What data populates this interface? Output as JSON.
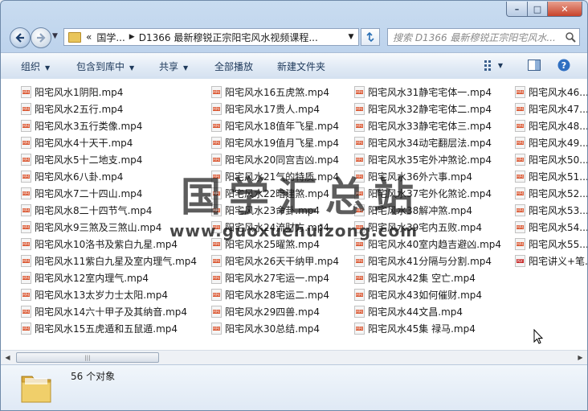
{
  "window": {
    "caption_buttons": {
      "minimize": "–",
      "maximize": "□",
      "close": "✕"
    }
  },
  "nav": {
    "back_icon": "back-arrow-icon",
    "forward_icon": "forward-arrow-icon",
    "breadcrumbs": [
      "«",
      "国学...",
      "D1366 最新穆锐正宗阳宅风水视频课程..."
    ],
    "search_placeholder": "搜索 D1366 最新穆锐正宗阳宅风水..."
  },
  "toolbar": {
    "organize": "组织",
    "include_in_library": "包含到库中",
    "share": "共享",
    "play_all": "全部播放",
    "new_folder": "新建文件夹"
  },
  "files": [
    [
      "阳宅风水1阴阳.mp4",
      "阳宅风水2五行.mp4",
      "阳宅风水3五行类像.mp4",
      "阳宅风水4十天干.mp4",
      "阳宅风水5十二地支.mp4",
      "阳宅风水6八卦.mp4",
      "阳宅风水7二十四山.mp4",
      "阳宅风水8二十四节气.mp4",
      "阳宅风水9三煞及三煞山.mp4",
      "阳宅风水10洛书及紫白九星.mp4",
      "阳宅风水11紫白九星及室内理气.mp4",
      "阳宅风水12室内理气.mp4",
      "阳宅风水13太岁力士太阳.mp4",
      "阳宅风水14六十甲子及其纳音.mp4",
      "阳宅风水15五虎遁和五鼠遁.mp4"
    ],
    [
      "阳宅风水16五虎煞.mp4",
      "阳宅风水17贵人.mp4",
      "阳宅风水18值年飞星.mp4",
      "阳宅风水19值月飞星.mp4",
      "阳宅风水20同宫吉凶.mp4",
      "阳宅风水21气的特质.mp4",
      "阳宅风水22暗建煞.mp4",
      "阳宅风水23命卦.mp4",
      "阳宅风水24流财方.mp4",
      "阳宅风水25曜煞.mp4",
      "阳宅风水26天干纳甲.mp4",
      "阳宅风水27宅运一.mp4",
      "阳宅风水28宅运二.mp4",
      "阳宅风水29四兽.mp4",
      "阳宅风水30总结.mp4"
    ],
    [
      "阳宅风水31静宅宅体一.mp4",
      "阳宅风水32静宅宅体二.mp4",
      "阳宅风水33静宅宅体三.mp4",
      "阳宅风水34动宅翻层法.mp4",
      "阳宅风水35宅外冲煞论.mp4",
      "阳宅风水36外六事.mp4",
      "阳宅风水37宅外化煞论.mp4",
      "阳宅风水38解冲煞.mp4",
      "阳宅风水39宅内五败.mp4",
      "阳宅风水40室内趋吉避凶.mp4",
      "阳宅风水41分隔与分割.mp4",
      "阳宅风水42集 空亡.mp4",
      "阳宅风水43如何催财.mp4",
      "阳宅风水44文昌.mp4",
      "阳宅风水45集 禄马.mp4"
    ],
    [
      "阳宅风水46...",
      "阳宅风水47...",
      "阳宅风水48...",
      "阳宅风水49...",
      "阳宅风水50...",
      "阳宅风水51...",
      "阳宅风水52...",
      "阳宅风水53...",
      "阳宅风水54...",
      "阳宅风水55...",
      "阳宅讲义+笔..."
    ]
  ],
  "file_icon_label": "MP4",
  "pdf_icon_label": "PDF",
  "watermark": {
    "cn": "国学汇总站",
    "url": "www.guoxuehuizong.com"
  },
  "status": {
    "count": "56 个对象"
  }
}
